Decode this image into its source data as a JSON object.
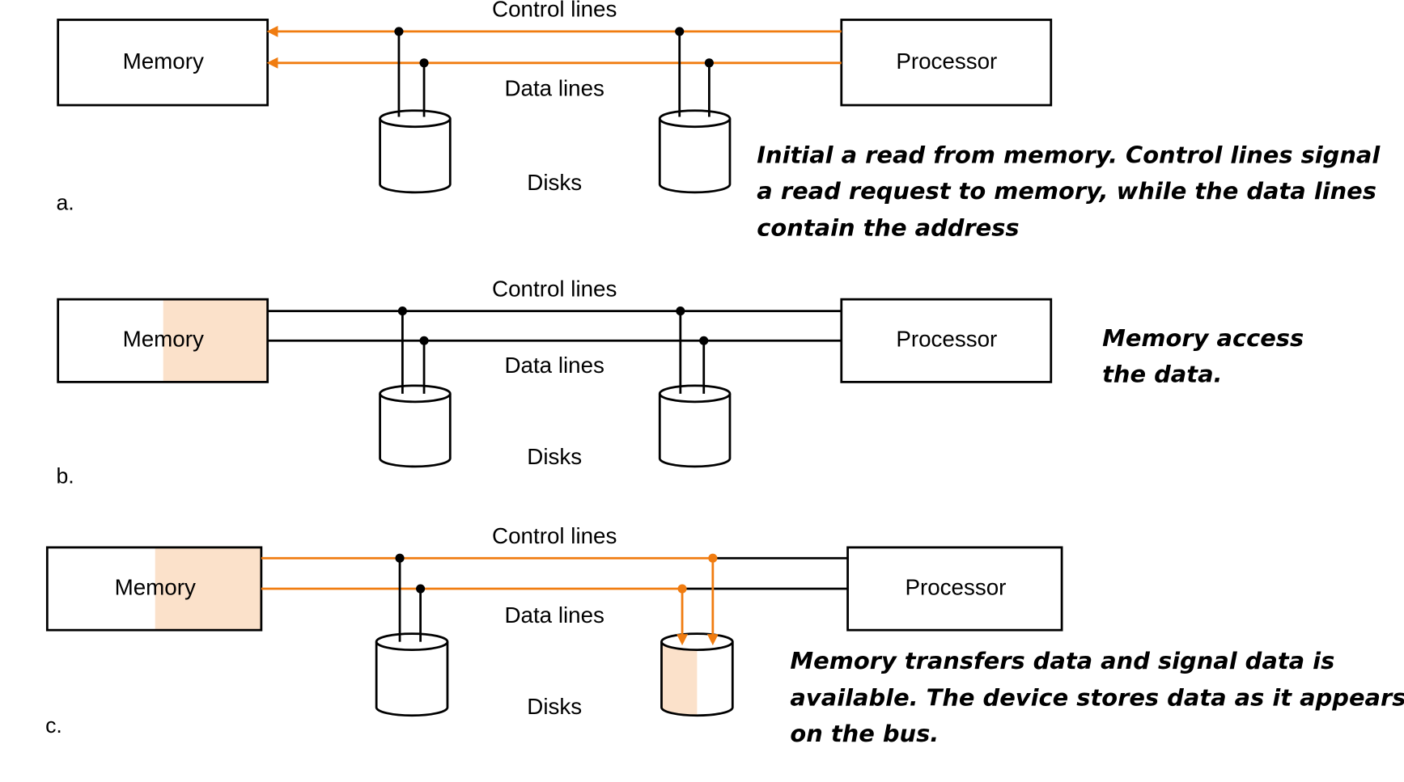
{
  "colors": {
    "active_line": "#f07c10",
    "highlight_fill": "#fbe1ca",
    "line": "#000000"
  },
  "labels": {
    "memory": "Memory",
    "processor": "Processor",
    "control_lines": "Control lines",
    "data_lines": "Data lines",
    "disks": "Disks"
  },
  "panels": [
    {
      "step": "a.",
      "caption": [
        "Initial a read from memory. Control lines signal",
        "a read request  to memory, while the data lines",
        "contain the address"
      ]
    },
    {
      "step": "b.",
      "caption": [
        "Memory access",
        "the data."
      ]
    },
    {
      "step": "c.",
      "caption": [
        "Memory transfers data and signal data is",
        "available. The device stores data as it appears",
        "on the bus."
      ]
    }
  ]
}
